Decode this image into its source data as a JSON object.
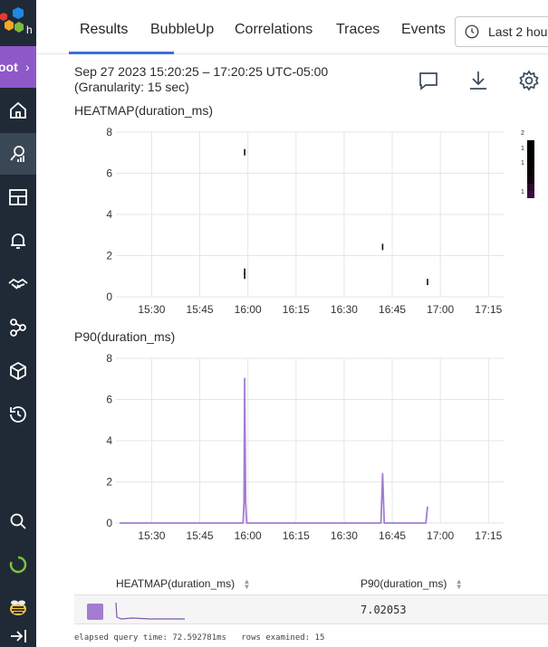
{
  "sidebar": {
    "team_label": "oot",
    "team_chevron": "›",
    "items": [
      {
        "name": "home-icon"
      },
      {
        "name": "query-icon"
      },
      {
        "name": "boards-icon"
      },
      {
        "name": "triggers-icon"
      },
      {
        "name": "slos-icon"
      },
      {
        "name": "service-map-icon"
      },
      {
        "name": "datasets-icon"
      },
      {
        "name": "history-icon"
      },
      {
        "name": "search-icon"
      },
      {
        "name": "status-ring-icon"
      },
      {
        "name": "bee-avatar-icon"
      },
      {
        "name": "collapse-icon"
      }
    ],
    "colors": {
      "bg": "#1f2a36",
      "team": "#8f58c9",
      "active": "#3a4755"
    }
  },
  "tabs": [
    "Results",
    "BubbleUp",
    "Correlations",
    "Traces",
    "Events"
  ],
  "active_tab": "Results",
  "time_button": "Last 2 hou",
  "range": {
    "line1": "Sep 27 2023 15:20:25 – 17:20:25 UTC-05:00",
    "line2": "(Granularity: 15 sec)"
  },
  "tools": [
    "comment-icon",
    "download-icon",
    "settings-icon"
  ],
  "heatmap": {
    "title": "HEATMAP(duration_ms)"
  },
  "p90": {
    "title": "P90(duration_ms)"
  },
  "legend_scale": {
    "labels": [
      "2",
      "1",
      "1",
      "1"
    ]
  },
  "table": {
    "col1": "HEATMAP(duration_ms)",
    "col2": "P90(duration_ms)",
    "value": "7.02053"
  },
  "footer": {
    "elapsed_label": "elapsed query time:",
    "elapsed_value": "72.592781ms",
    "rows_label": "rows examined:",
    "rows_value": "15"
  },
  "chart_data": [
    {
      "type": "heatmap",
      "title": "HEATMAP(duration_ms)",
      "x_ticks": [
        "15:30",
        "15:45",
        "16:00",
        "16:15",
        "16:30",
        "16:45",
        "17:00",
        "17:15"
      ],
      "y_ticks": [
        "0",
        "2",
        "4",
        "6",
        "8"
      ],
      "ylim": [
        0,
        8
      ],
      "xlim_minutes": [
        "15:20",
        "17:20"
      ],
      "points": [
        {
          "x": "15:59",
          "y": 7.0
        },
        {
          "x": "15:59",
          "y": 1.2
        },
        {
          "x": "15:59",
          "y": 1.0
        },
        {
          "x": "16:42",
          "y": 2.4
        },
        {
          "x": "16:56",
          "y": 0.7
        }
      ],
      "grid": true
    },
    {
      "type": "line",
      "title": "P90(duration_ms)",
      "x_ticks": [
        "15:30",
        "15:45",
        "16:00",
        "16:15",
        "16:30",
        "16:45",
        "17:00",
        "17:15"
      ],
      "y_ticks": [
        "0",
        "2",
        "4",
        "6",
        "8"
      ],
      "ylim": [
        0,
        8
      ],
      "xlim_minutes": [
        "15:20",
        "17:20"
      ],
      "series": [
        {
          "color": "#a27dd0",
          "points": [
            {
              "x": "15:20",
              "y": 0
            },
            {
              "x": "15:58.5",
              "y": 0
            },
            {
              "x": "15:58.8",
              "y": 1.0
            },
            {
              "x": "15:59",
              "y": 7.02
            },
            {
              "x": "15:59.3",
              "y": 1.0
            },
            {
              "x": "15:59.6",
              "y": 0
            },
            {
              "x": "16:41.5",
              "y": 0
            },
            {
              "x": "16:42",
              "y": 2.4
            },
            {
              "x": "16:42.5",
              "y": 0
            },
            {
              "x": "16:55.5",
              "y": 0
            },
            {
              "x": "16:56",
              "y": 0.8
            }
          ]
        }
      ],
      "grid": true
    }
  ]
}
